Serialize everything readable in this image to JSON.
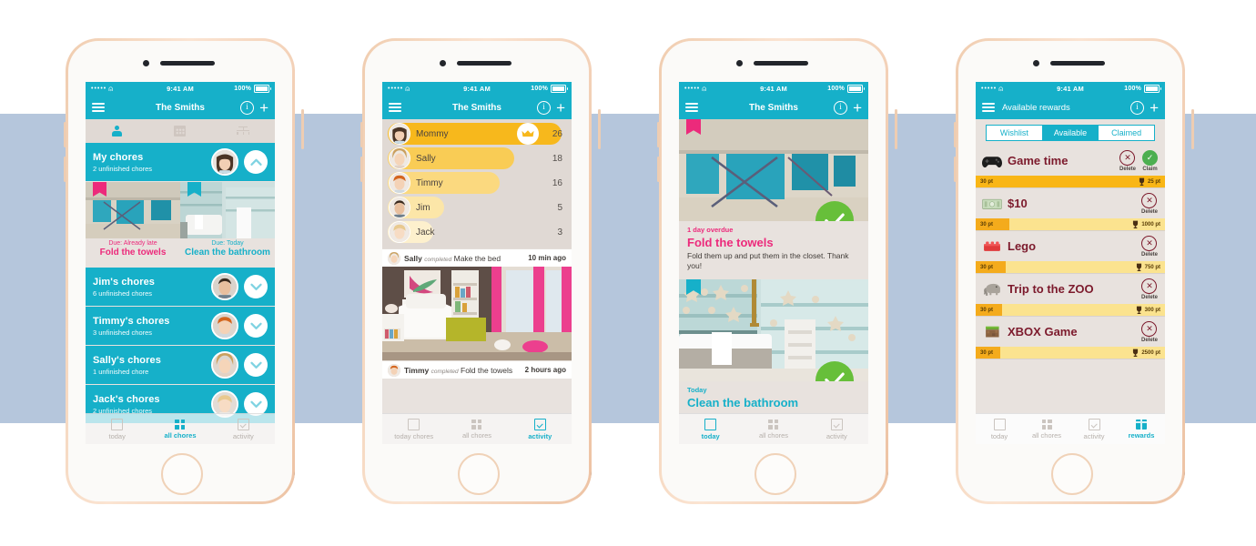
{
  "background": {
    "band_color": "#b5c6dc",
    "page_color": "#ffffff"
  },
  "theme": {
    "teal": "#16b0c9",
    "pink": "#ec2a7b",
    "yellow": "#f4ab1c",
    "green": "#67bf3a",
    "maroon": "#7c1a2c",
    "beige": "#e8e2de"
  },
  "status_bar": {
    "signal": "•••••",
    "wifi": "wifi-icon",
    "time": "9:41 AM",
    "battery_pct": "100%"
  },
  "phone1": {
    "nav": {
      "menu": "menu-icon",
      "title": "The Smiths",
      "info": "i",
      "add": "+"
    },
    "segments": [
      {
        "name": "person-icon",
        "active": true
      },
      {
        "name": "calendar-icon",
        "active": false
      },
      {
        "name": "family-tree-icon",
        "active": false
      }
    ],
    "groups": [
      {
        "name": "My chores",
        "sub": "2 unfinished chores",
        "expanded": true,
        "chevron": "chevron-up-icon"
      },
      {
        "name": "Jim's chores",
        "sub": "6 unfinished chores",
        "expanded": false,
        "chevron": "chevron-down-icon"
      },
      {
        "name": "Timmy's chores",
        "sub": "3 unfinished chores",
        "expanded": false,
        "chevron": "chevron-down-icon"
      },
      {
        "name": "Sally's chores",
        "sub": "1 unfinished chore",
        "expanded": false,
        "chevron": "chevron-down-icon"
      },
      {
        "name": "Jack's chores",
        "sub": "2 unfinished chores",
        "expanded": false,
        "chevron": "chevron-down-icon"
      }
    ],
    "chores": [
      {
        "due_label": "Due: Already late",
        "title": "Fold the towels",
        "state": "late",
        "image": "laundry-drying-rack"
      },
      {
        "due_label": "Due: Today",
        "title": "Clean the bathroom",
        "state": "today",
        "image": "bathroom-shelves"
      }
    ],
    "tabbar": [
      {
        "label": "today",
        "icon": "square-icon",
        "active": false
      },
      {
        "label": "all chores",
        "icon": "grid-icon",
        "active": true
      },
      {
        "label": "activity",
        "icon": "check-square-icon",
        "active": false
      }
    ]
  },
  "phone2": {
    "nav": {
      "menu": "menu-icon",
      "title": "The Smiths",
      "info": "i",
      "add": "+"
    },
    "leaderboard": [
      {
        "name": "Mommy",
        "points": "26",
        "bar_pct": 92,
        "crown": true
      },
      {
        "name": "Sally",
        "points": "18",
        "bar_pct": 67,
        "crown": false
      },
      {
        "name": "Timmy",
        "points": "16",
        "bar_pct": 59,
        "crown": false
      },
      {
        "name": "Jim",
        "points": "5",
        "bar_pct": 30,
        "crown": false
      },
      {
        "name": "Jack",
        "points": "3",
        "bar_pct": 24,
        "crown": false
      }
    ],
    "feed": [
      {
        "who": "Sally",
        "verb": "completed",
        "what": "Make the bed",
        "when": "10 min ago",
        "image": "girls-bedroom"
      },
      {
        "who": "Timmy",
        "verb": "completed",
        "what": "Fold the towels",
        "when": "2 hours ago",
        "image": ""
      }
    ],
    "tabbar": [
      {
        "label": "today chores",
        "icon": "square-icon",
        "active": false
      },
      {
        "label": "all chores",
        "icon": "grid-icon",
        "active": false
      },
      {
        "label": "activity",
        "icon": "check-square-icon",
        "active": true
      }
    ]
  },
  "phone3": {
    "nav": {
      "menu": "menu-icon",
      "title": "The Smiths",
      "info": "i",
      "add": "+"
    },
    "cards": [
      {
        "image": "laundry-drying-rack",
        "tag_color": "pink",
        "due": "1 day overdue",
        "title": "Fold the towels",
        "desc": "Fold them up and put them in the closet. Thank you!",
        "state": "late",
        "check": "check-icon"
      },
      {
        "image": "bathroom-shelves",
        "tag_color": "teal",
        "due": "Today",
        "title": "Clean the bathroom",
        "desc": "",
        "state": "today",
        "check": "check-icon"
      }
    ],
    "tabbar": [
      {
        "label": "today",
        "icon": "square-icon",
        "active": true
      },
      {
        "label": "all chores",
        "icon": "grid-icon",
        "active": false
      },
      {
        "label": "activity",
        "icon": "check-square-icon",
        "active": false
      }
    ]
  },
  "phone4": {
    "nav": {
      "menu": "menu-icon",
      "title": "Available rewards",
      "info": "i",
      "add": "+"
    },
    "segtabs": [
      {
        "label": "Wishlist",
        "active": false
      },
      {
        "label": "Available",
        "active": true
      },
      {
        "label": "Claimed",
        "active": false
      }
    ],
    "rewards": [
      {
        "icon": "gamepad-icon",
        "title": "Game time",
        "delete": "Delete",
        "claim": "Claim",
        "has_claim": true,
        "current": "30 pt",
        "total": "25 pt",
        "fill_pct": 100
      },
      {
        "icon": "money-icon",
        "title": "$10",
        "delete": "Delete",
        "claim": "",
        "has_claim": false,
        "current": "30 pt",
        "total": "1000 pt",
        "fill_pct": 18
      },
      {
        "icon": "lego-brick-icon",
        "title": "Lego",
        "delete": "Delete",
        "claim": "",
        "has_claim": false,
        "current": "30 pt",
        "total": "750 pt",
        "fill_pct": 16
      },
      {
        "icon": "elephant-icon",
        "title": "Trip to the ZOO",
        "delete": "Delete",
        "claim": "",
        "has_claim": false,
        "current": "30 pt",
        "total": "300 pt",
        "fill_pct": 14
      },
      {
        "icon": "minecraft-block-icon",
        "title": "XBOX Game",
        "delete": "Delete",
        "claim": "",
        "has_claim": false,
        "current": "30 pt",
        "total": "2500 pt",
        "fill_pct": 13
      }
    ],
    "tabbar": [
      {
        "label": "today",
        "icon": "square-icon",
        "active": false
      },
      {
        "label": "all chores",
        "icon": "grid-icon",
        "active": false
      },
      {
        "label": "activity",
        "icon": "check-square-icon",
        "active": false
      },
      {
        "label": "rewards",
        "icon": "gift-icon",
        "active": true
      }
    ]
  }
}
